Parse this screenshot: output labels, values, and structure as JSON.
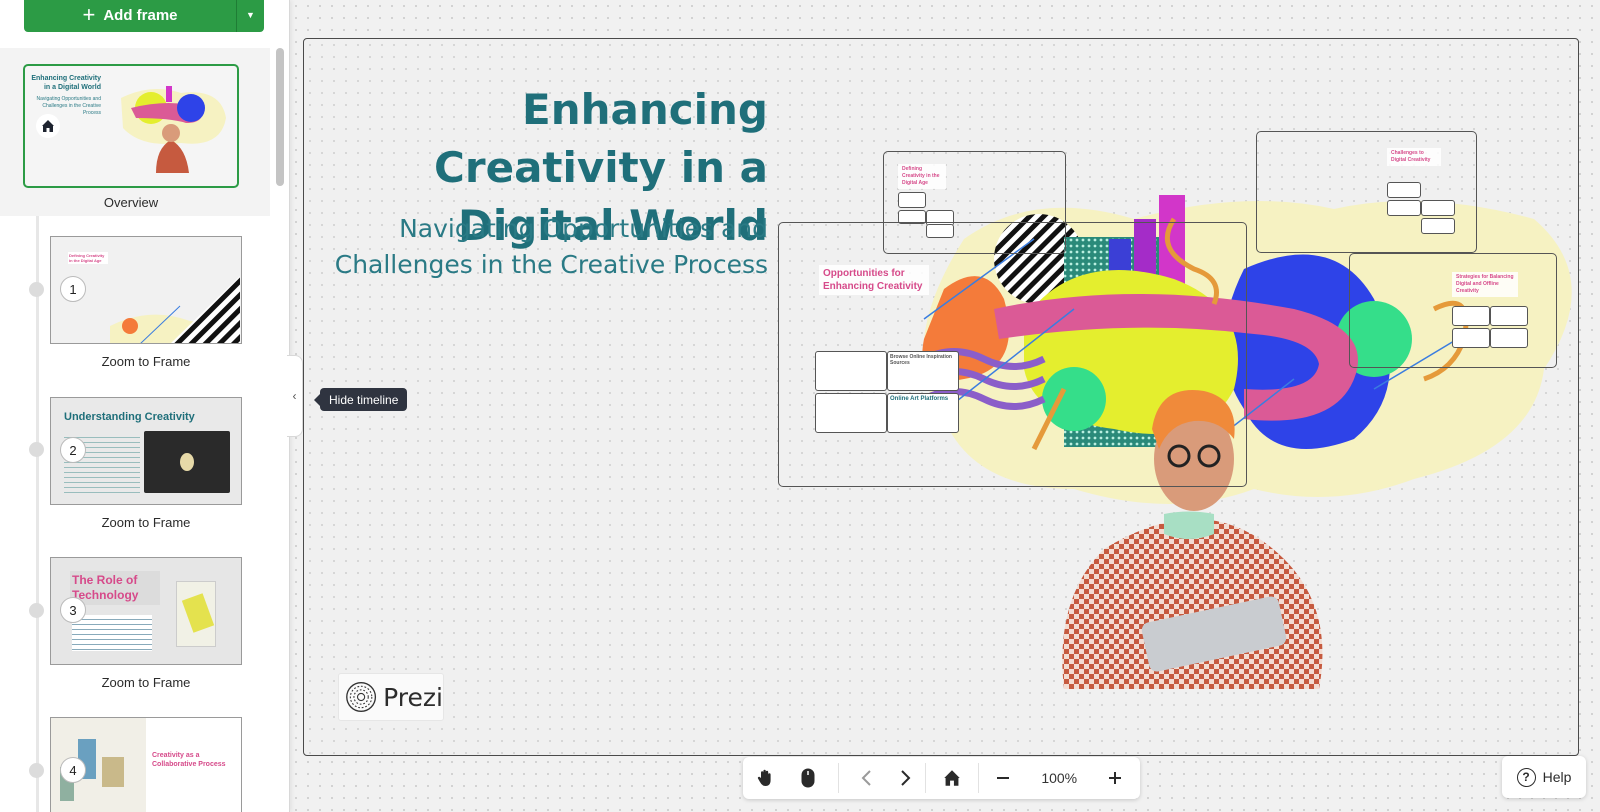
{
  "sidebar": {
    "add_frame_label": "Add frame",
    "overview": {
      "label": "Overview",
      "thumb_title": "Enhancing Creativity in a Digital World",
      "thumb_subtitle": "Navigating Opportunities and Challenges in the Creative Process"
    },
    "frames": [
      {
        "number": "1",
        "label": "Zoom to Frame",
        "thumb_text": "Defining Creativity in the Digital Age"
      },
      {
        "number": "2",
        "label": "Zoom to Frame",
        "thumb_text": "Understanding Creativity"
      },
      {
        "number": "3",
        "label": "Zoom to Frame",
        "thumb_text": "The Role of Technology"
      },
      {
        "number": "4",
        "label": "",
        "thumb_text": "Creativity as a Collaborative Process"
      }
    ],
    "hide_tooltip": "Hide timeline"
  },
  "canvas": {
    "title": "Enhancing Creativity in a Digital World",
    "subtitle": "Navigating Opportunities and Challenges in the Creative Process",
    "logo_text": "Prezi",
    "subframes": {
      "defining": "Defining Creativity in the Digital Age",
      "opportunities": "Opportunities for Enhancing Creativity",
      "challenges": "Challenges to Digital Creativity",
      "strategies": "Strategies for Balancing Digital and Offline Creativity",
      "online_inspiration": "Browse Online Inspiration Sources",
      "online_art": "Online Art Platforms"
    }
  },
  "toolbar": {
    "zoom_level": "100%"
  },
  "help_label": "Help",
  "colors": {
    "brand_green": "#2c9b45",
    "title_teal": "#1f6f7a",
    "accent_pink": "#d64a8a"
  }
}
